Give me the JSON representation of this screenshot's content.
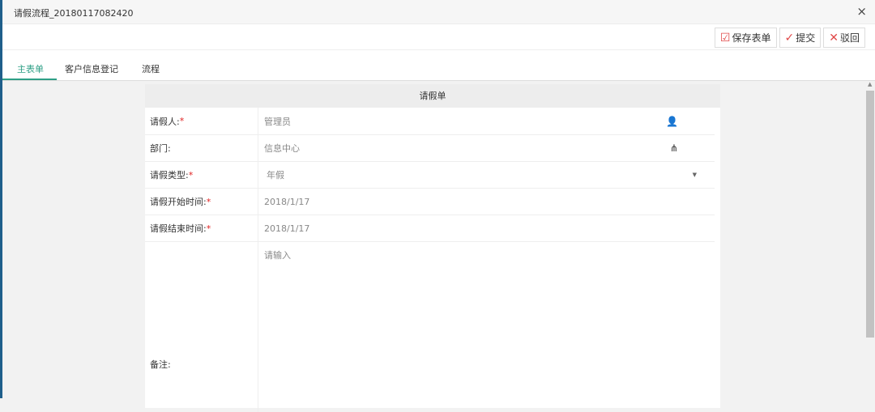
{
  "window": {
    "title": "请假流程_20180117082420",
    "close": "×"
  },
  "toolbar": {
    "save": "保存表单",
    "submit": "提交",
    "reject": "驳回"
  },
  "tabs": [
    {
      "label": "主表单"
    },
    {
      "label": "客户信息登记"
    },
    {
      "label": "流程"
    }
  ],
  "form": {
    "title": "请假单",
    "required_mark": "*",
    "rows": [
      {
        "label": "请假人:",
        "value": "管理员"
      },
      {
        "label": "部门:",
        "value": "信息中心"
      },
      {
        "label": "请假类型:",
        "value": "年假"
      },
      {
        "label": "请假开始时间:",
        "value": "2018/1/17"
      },
      {
        "label": "请假结束时间:",
        "value": "2018/1/17"
      },
      {
        "label": "备注:",
        "placeholder": "请输入"
      }
    ]
  }
}
